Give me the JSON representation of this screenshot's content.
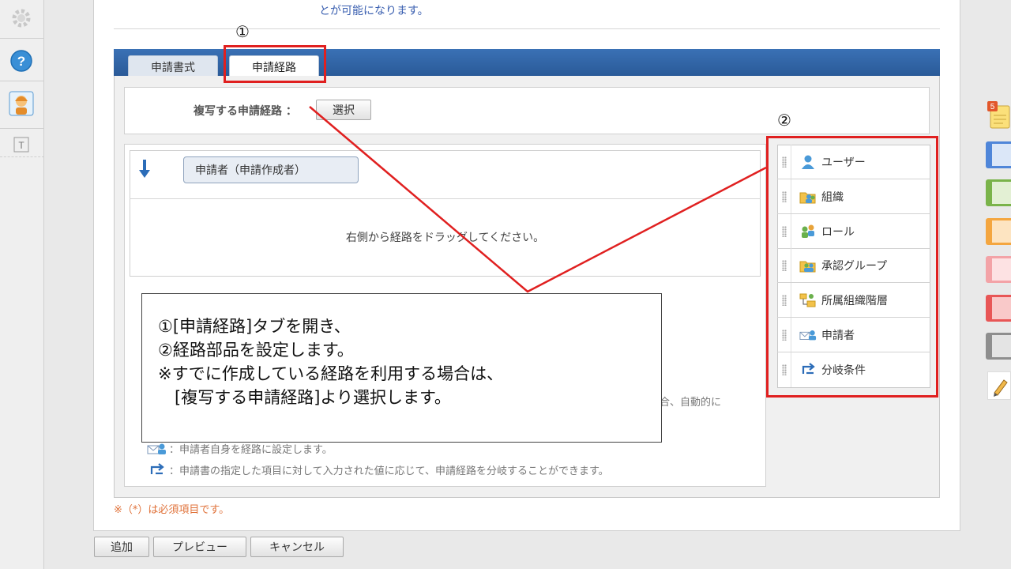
{
  "top_note": "とが可能になります。",
  "tabs": [
    {
      "label": "申請書式"
    },
    {
      "label": "申請経路"
    }
  ],
  "copy_route": {
    "label": "複写する申請経路 ：",
    "select_button": "選択"
  },
  "route": {
    "applicant_chip": "申請者（申請作成者）",
    "drag_hint": "右側から経路をドラッグしてください。"
  },
  "legend": {
    "partial_line": "合、自動的に",
    "applicant_line": "：申請者自身を経路に設定します。",
    "branch_line": "：申請書の指定した項目に対して入力された値に応じて、申請経路を分岐することができます。"
  },
  "required_note": "※（*）は必須項目です。",
  "parts": [
    {
      "label": "ユーザー",
      "icon": "user-icon"
    },
    {
      "label": "組織",
      "icon": "organization-icon"
    },
    {
      "label": "ロール",
      "icon": "role-icon"
    },
    {
      "label": "承認グループ",
      "icon": "approval-group-icon"
    },
    {
      "label": "所属組織階層",
      "icon": "org-hierarchy-icon"
    },
    {
      "label": "申請者",
      "icon": "applicant-icon"
    },
    {
      "label": "分岐条件",
      "icon": "branch-icon"
    }
  ],
  "annotations": {
    "marker1": "①",
    "marker2": "②",
    "callout_lines": [
      "①[申請経路]タブを開き、",
      "②経路部品を設定します。",
      "※すでに作成している経路を利用する場合は、",
      "　[複写する申請経路]より選択します。"
    ]
  },
  "footer": {
    "add": "追加",
    "preview": "プレビュー",
    "cancel": "キャンセル"
  },
  "colors": {
    "tabbar": "#2f64a8",
    "highlight": "#e02020",
    "required_text": "#e0723a",
    "right_swatches": [
      "#4f86d9",
      "#7ab34a",
      "#f4a640",
      "#f3a3a7",
      "#e85656",
      "#8e8e8e"
    ]
  }
}
